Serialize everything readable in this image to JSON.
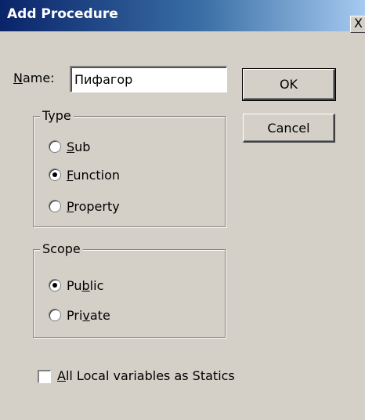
{
  "window": {
    "title": "Add Procedure",
    "close_glyph": "X"
  },
  "name_field": {
    "label_accel": "N",
    "label_rest": "ame:",
    "value": "Пифагор"
  },
  "buttons": {
    "ok": "OK",
    "cancel": "Cancel"
  },
  "type_group": {
    "legend": "Type",
    "options": [
      {
        "accel": "S",
        "rest": "ub",
        "checked": false
      },
      {
        "accel": "F",
        "rest": "unction",
        "checked": true
      },
      {
        "accel": "P",
        "rest": "roperty",
        "checked": false
      }
    ]
  },
  "scope_group": {
    "legend": "Scope",
    "options": [
      {
        "pre": "Pu",
        "accel": "b",
        "rest": "lic",
        "checked": true
      },
      {
        "pre": "Pri",
        "accel": "v",
        "rest": "ate",
        "checked": false
      }
    ]
  },
  "statics_checkbox": {
    "accel": "A",
    "rest": "ll Local variables as Statics",
    "checked": false
  },
  "colors": {
    "face": "#d4d0c8",
    "title_start": "#0a246a",
    "title_end": "#a6caf0"
  }
}
